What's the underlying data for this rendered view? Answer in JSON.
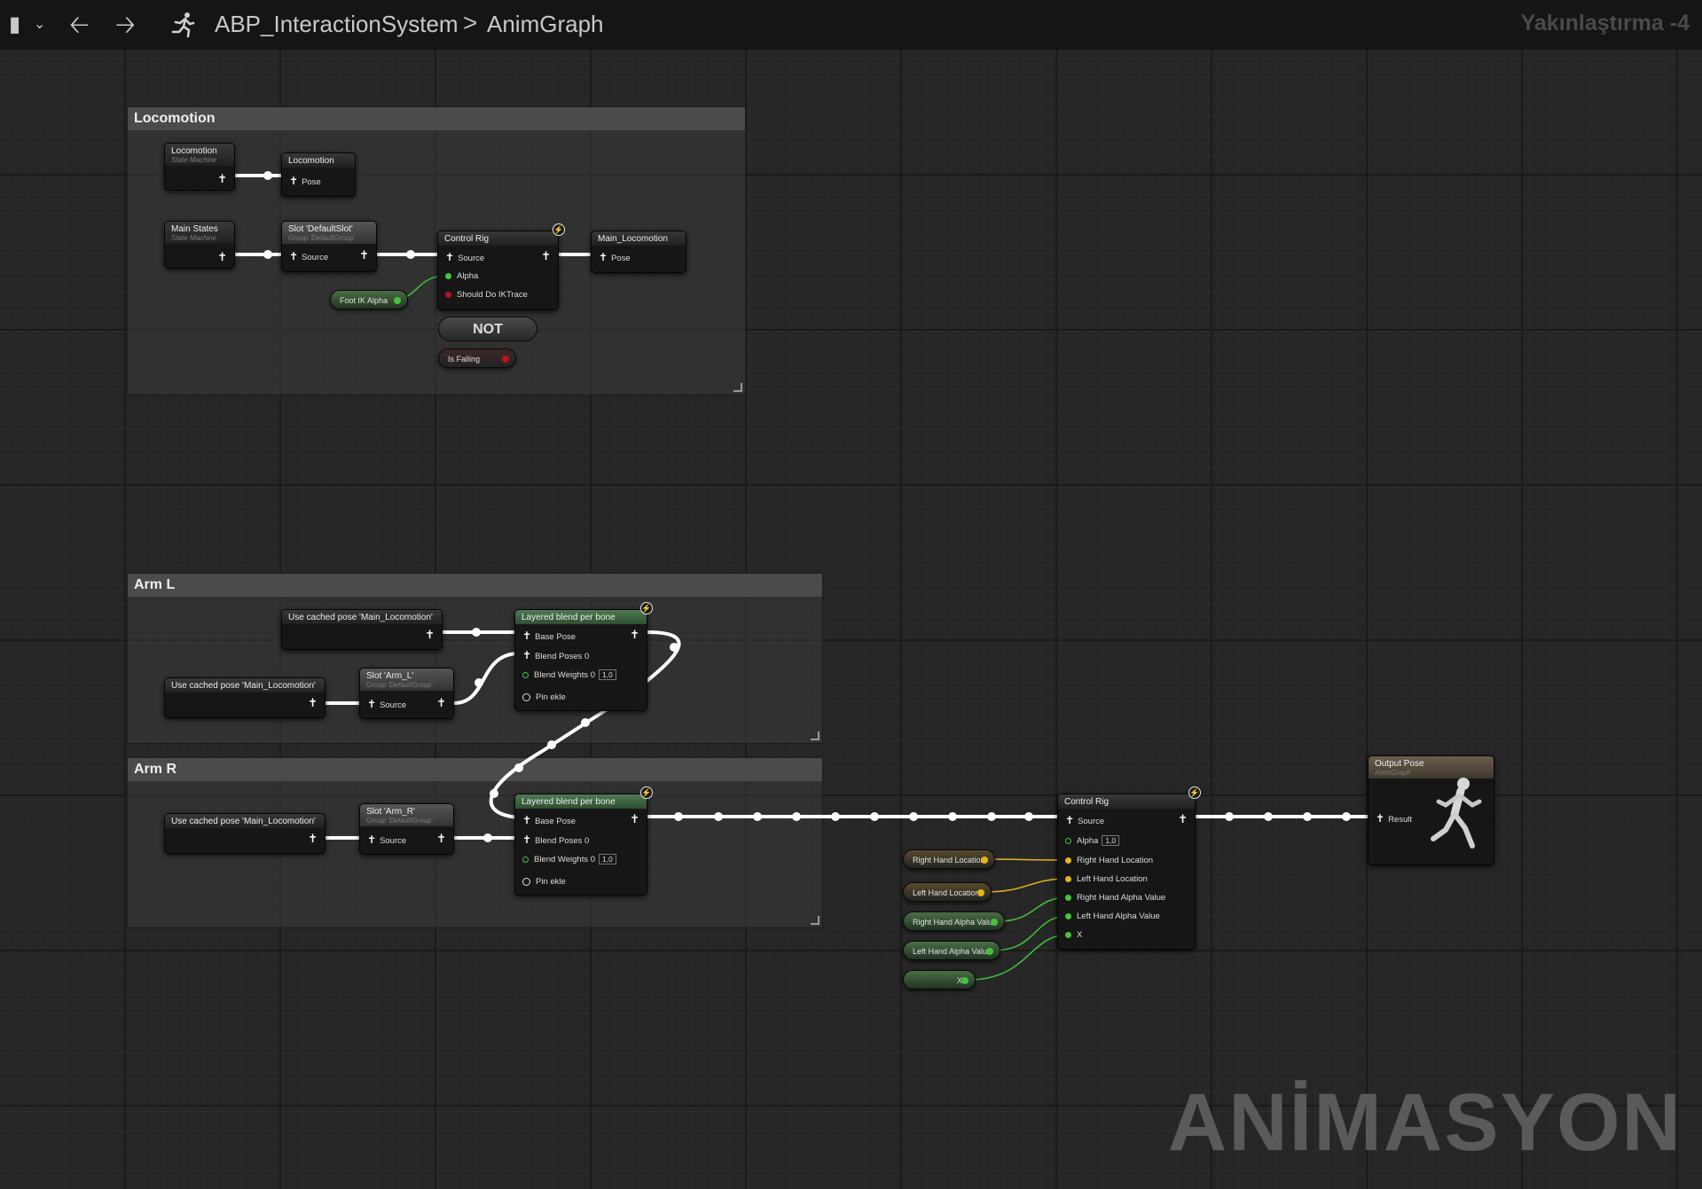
{
  "toolbar": {
    "asset_name": "ABP_InteractionSystem",
    "separator": ">",
    "graph_name": "AnimGraph",
    "zoom_label": "Yakınlaştırma -4",
    "icons": [
      "bookmark-icon",
      "chevron-down-icon",
      "back-arrow-icon",
      "forward-arrow-icon",
      "running-man-icon"
    ]
  },
  "comments": {
    "locomotion": "Locomotion",
    "arm_l": "Arm L",
    "arm_r": "Arm R"
  },
  "nodes": {
    "loc_sm": {
      "title": "Locomotion",
      "subtitle": "State Machine"
    },
    "loc_cache": {
      "title": "Locomotion",
      "pin": "Pose"
    },
    "main_states": {
      "title": "Main States",
      "subtitle": "State Machine"
    },
    "slot_default": {
      "title": "Slot 'DefaultSlot'",
      "subtitle": "Group 'DefaultGroup'",
      "pin": "Source"
    },
    "control_rig_1": {
      "title": "Control Rig",
      "pins": [
        "Source",
        "Alpha",
        "Should Do IKTrace"
      ]
    },
    "main_loc_cache": {
      "title": "Main_Locomotion",
      "pin": "Pose"
    },
    "not_node": {
      "label": "NOT"
    },
    "foot_ik_alpha": {
      "label": "Foot IK Alpha"
    },
    "is_falling": {
      "label": "Is Falling"
    },
    "cached_l1": {
      "title": "Use cached pose 'Main_Locomotion'"
    },
    "cached_l2": {
      "title": "Use cached pose 'Main_Locomotion'"
    },
    "slot_arm_l": {
      "title": "Slot 'Arm_L'",
      "subtitle": "Group 'DefaultGroup'",
      "pin": "Source"
    },
    "lbpb_l": {
      "title": "Layered blend per bone",
      "pins": [
        "Base Pose",
        "Blend Poses 0",
        "Blend Weights 0",
        "Pin ekle"
      ],
      "weight": "1,0"
    },
    "cached_r": {
      "title": "Use cached pose 'Main_Locomotion'"
    },
    "slot_arm_r": {
      "title": "Slot 'Arm_R'",
      "subtitle": "Group 'DefaultGroup'",
      "pin": "Source"
    },
    "lbpb_r": {
      "title": "Layered blend per bone",
      "pins": [
        "Base Pose",
        "Blend Poses 0",
        "Blend Weights 0",
        "Pin ekle"
      ],
      "weight": "1,0"
    },
    "control_rig_2": {
      "title": "Control Rig",
      "pins": [
        "Source",
        "Alpha",
        "Right Hand Location",
        "Left Hand Location",
        "Right Hand Alpha Value",
        "Left Hand Alpha Value",
        "X"
      ],
      "alpha": "1,0"
    },
    "output_pose": {
      "title": "Output Pose",
      "subtitle": "AnimGraph",
      "pin": "Result"
    }
  },
  "variables": {
    "right_hand_location": "Right Hand Location",
    "left_hand_location": "Left Hand Location",
    "right_hand_alpha_value": "Right Hand Alpha Value",
    "left_hand_alpha_value": "Left Hand Alpha Value",
    "x": "X"
  },
  "colors": {
    "pose_wire": "#ffffff",
    "float_pin": "#46c33d",
    "vector_pin": "#e6b41e",
    "bool_pin": "#b8141e"
  },
  "watermark": "ANİMASYON"
}
